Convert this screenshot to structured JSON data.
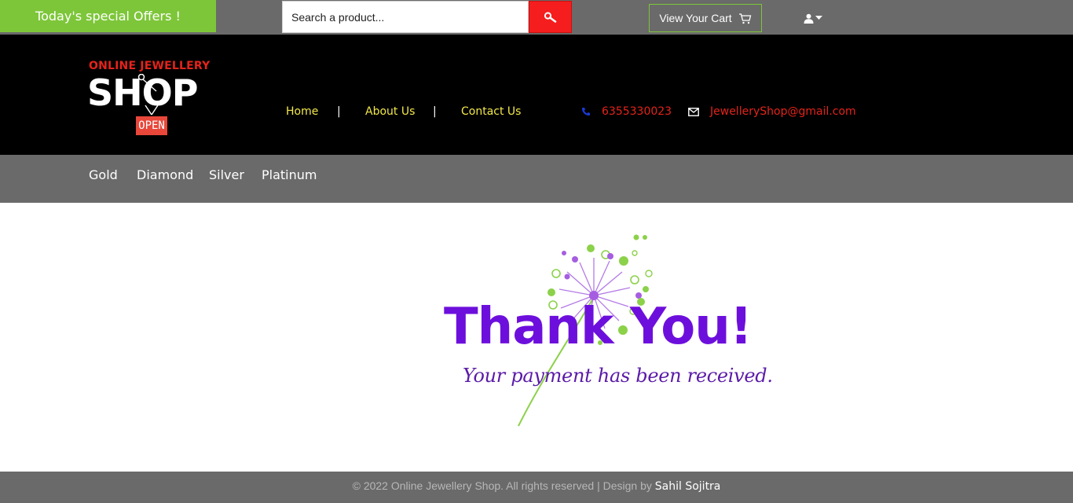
{
  "topbar": {
    "offers_label": "Today's special Offers !",
    "search_placeholder": "Search a product...",
    "cart_label": "View Your Cart"
  },
  "header": {
    "logo_top": "ONLINE JEWELLERY",
    "logo_main": "SHOP",
    "logo_badge": "OPEN",
    "nav": [
      {
        "label": "Home"
      },
      {
        "label": "About Us"
      },
      {
        "label": "Contact Us"
      }
    ],
    "nav_separator": "|",
    "phone": "6355330023",
    "email": "JewelleryShop@gmail.com"
  },
  "categories": [
    {
      "label": "Gold"
    },
    {
      "label": "Diamond"
    },
    {
      "label": "Silver"
    },
    {
      "label": "Platinum"
    }
  ],
  "thanks": {
    "title": "Thank You!",
    "subtitle": "Your payment has been received."
  },
  "footer": {
    "copyright": "© 2022 Online Jewellery Shop. All rights reserved | Design by ",
    "author": "Sahil Sojitra"
  },
  "colors": {
    "offers_bg": "#7dc639",
    "search_button": "#f51d1d",
    "topbar_bg": "#6a6a6a",
    "header_bg": "#000000",
    "nav_link": "#f2e84a",
    "contact_text": "#e4231b",
    "thank_purple": "#6d0fdc",
    "dandelion_green": "#8cd14a",
    "dandelion_violet": "#a65ee0"
  },
  "icons": {
    "search": "search-icon",
    "cart": "cart-icon",
    "user": "user-icon",
    "phone": "phone-icon",
    "email": "envelope-icon"
  }
}
